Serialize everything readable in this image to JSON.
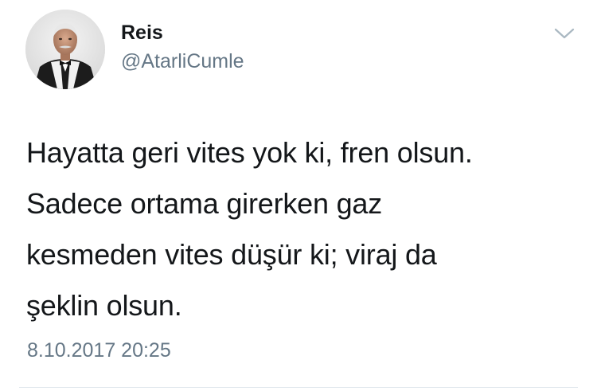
{
  "tweet": {
    "author": {
      "name": "Reis",
      "handle": "@AtarliCumle"
    },
    "text": "Hayatta geri vites yok ki, fren olsun.\nSadece ortama girerken gaz\nkesmeden vites düşür ki; viraj da\nşeklin olsun.",
    "timestamp": "8.10.2017 20:25",
    "menu_icon": "chevron-down-icon"
  },
  "colors": {
    "text": "#14171a",
    "secondary_text": "#657786",
    "divider": "#e1e8ed",
    "chevron": "#aab8c2"
  }
}
